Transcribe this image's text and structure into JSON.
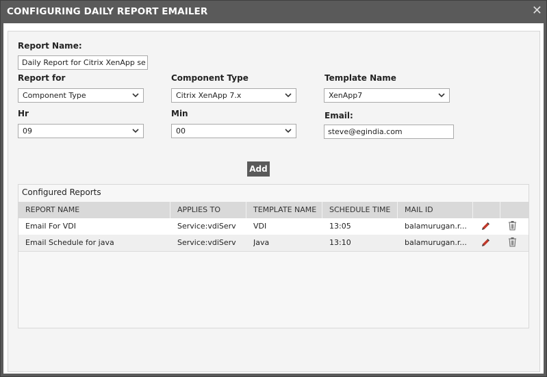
{
  "dialog": {
    "title": "CONFIGURING DAILY REPORT EMAILER",
    "close_label": "✕"
  },
  "form": {
    "report_name_label": "Report Name:",
    "report_name_value": "Daily Report for Citrix XenApp se",
    "report_for_label": "Report for",
    "report_for_value": "Component Type",
    "component_type_label": "Component Type",
    "component_type_value": "Citrix XenApp 7.x",
    "template_name_label": "Template Name",
    "template_name_value": "XenApp7",
    "hr_label": "Hr",
    "hr_value": "09",
    "min_label": "Min",
    "min_value": "00",
    "email_label": "Email:",
    "email_value": "steve@egindia.com",
    "add_label": "Add"
  },
  "configured_reports": {
    "caption": "Configured Reports",
    "columns": [
      "REPORT NAME",
      "APPLIES TO",
      "TEMPLATE NAME",
      "SCHEDULE TIME",
      "MAIL ID"
    ],
    "rows": [
      {
        "report_name": "Email For VDI",
        "applies_to": "Service:vdiServ",
        "template_name": "VDI",
        "schedule_time": "13:05",
        "mail_id": "balamurugan.r..."
      },
      {
        "report_name": "Email Schedule for java",
        "applies_to": "Service:vdiServ",
        "template_name": "Java",
        "schedule_time": "13:10",
        "mail_id": "balamurugan.r..."
      }
    ],
    "row_icons": [
      "pencil-icon",
      "trash-icon"
    ]
  },
  "colors": {
    "titlebar": "#5a5a5a",
    "panel": "#f4f4f4",
    "header_row": "#d9d9d9",
    "edit_icon": "#c0392b"
  }
}
